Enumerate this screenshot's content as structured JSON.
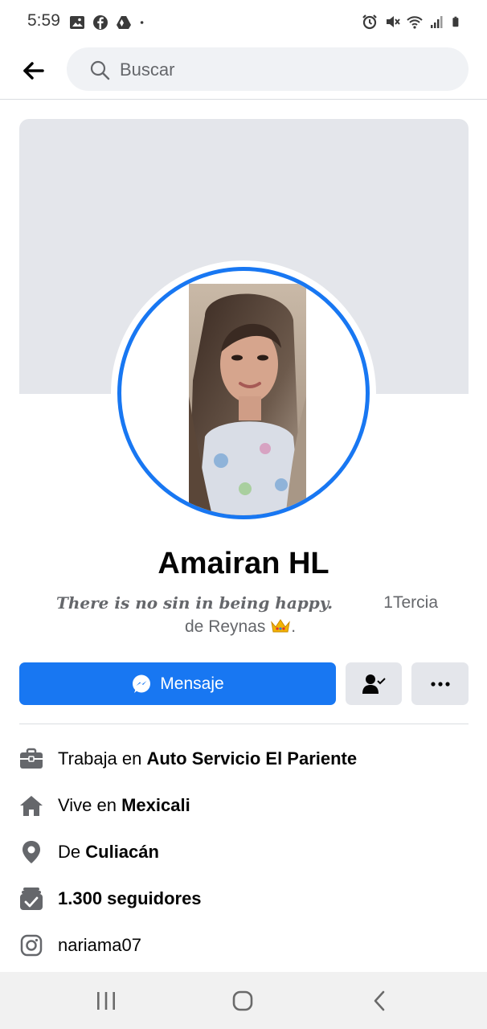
{
  "status_bar": {
    "time": "5:59",
    "left_icons": [
      "gallery-icon",
      "facebook-icon",
      "drive-icon",
      "dot-icon"
    ],
    "right_icons": [
      "alarm-icon",
      "mute-icon",
      "wifi-icon",
      "signal-icon",
      "battery-icon"
    ]
  },
  "search": {
    "placeholder": "Buscar"
  },
  "profile": {
    "name": "Amairan HL",
    "bio_quote": "There is no sin in being happy.",
    "bio_tag": "1Tercia",
    "bio_line2": "de Reynas",
    "bio_end": ".",
    "bio_emoji": "crown-icon"
  },
  "actions": {
    "message_label": "Mensaje",
    "friend_icon": "friends-check-icon",
    "more_icon": "more-icon"
  },
  "details": [
    {
      "icon": "briefcase-icon",
      "prefix": "Trabaja en ",
      "value": "Auto Servicio El Pariente"
    },
    {
      "icon": "home-icon",
      "prefix": "Vive en ",
      "value": "Mexicali"
    },
    {
      "icon": "location-icon",
      "prefix": "De ",
      "value": "Culiacán"
    },
    {
      "icon": "followers-icon",
      "prefix": "",
      "value": "1.300 seguidores"
    },
    {
      "icon": "instagram-icon",
      "prefix": "nariama07",
      "value": ""
    }
  ],
  "nav": [
    "recents-icon",
    "home-nav-icon",
    "back-nav-icon"
  ],
  "colors": {
    "accent": "#1877f2",
    "secondary_text": "#65676b",
    "button_grey": "#e4e6eb",
    "cover_grey": "#e4e6eb"
  }
}
